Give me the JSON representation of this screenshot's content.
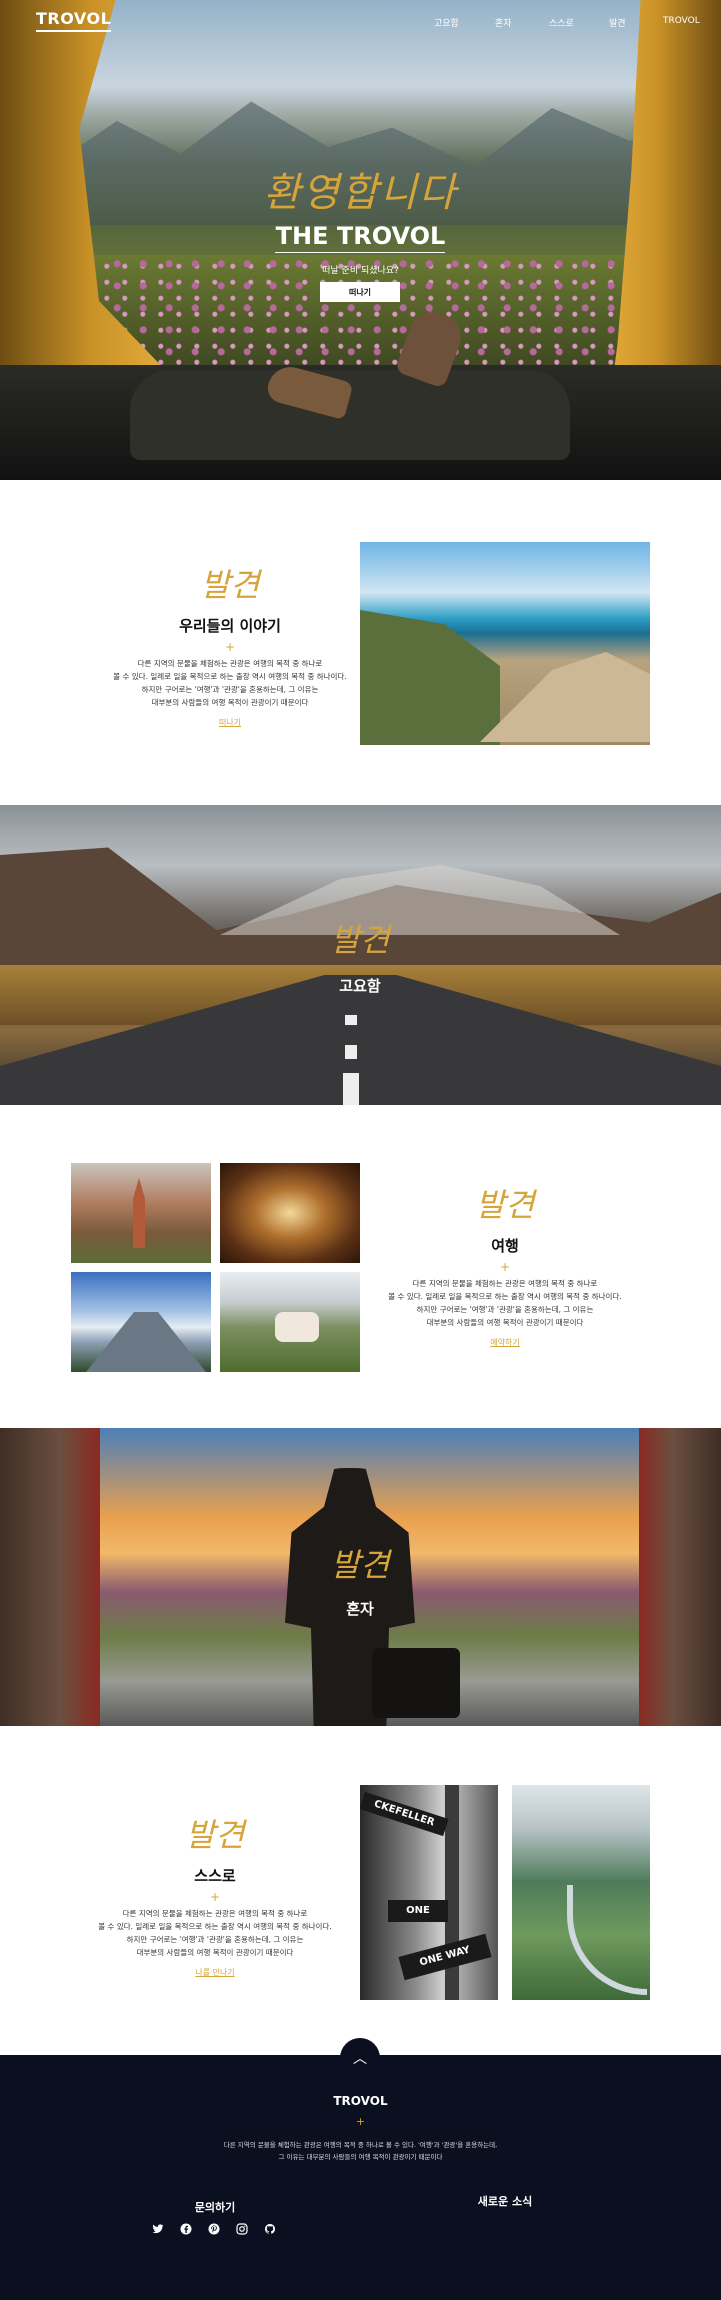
{
  "brand": {
    "logo": "TROVOL"
  },
  "nav": {
    "items": [
      "고요함",
      "혼자",
      "스스로",
      "발견",
      "TROVOL"
    ]
  },
  "hero": {
    "script": "환영합니다",
    "title": "THE TROVOL",
    "subtitle": "떠날 준비 되셨나요?",
    "button": "떠나기"
  },
  "story": {
    "script": "발견",
    "title": "우리들의 이야기",
    "plus": "+",
    "lines": [
      "다른 지역의 문물을 체험하는 관광은 여행의 목적 중 하나로",
      "볼 수 있다. 일례로 일을 목적으로 하는 출장 역시 여행의 목적 중 하나이다.",
      "하지만 구어로는 '여행'과 '관광'을 혼용하는데, 그 이유는",
      "대부분의 사람들의 여행 목적이 관광이기 때문이다"
    ],
    "link": "떠나기"
  },
  "calm": {
    "script": "발견",
    "title": "고요함"
  },
  "travel": {
    "script": "발견",
    "title": "여행",
    "plus": "+",
    "lines": [
      "다른 지역의 문물을 체험하는 관광은 여행의 목적 중 하나로",
      "볼 수 있다. 일례로 일을 목적으로 하는 출장 역시 여행의 목적 중 하나이다.",
      "하지만 구어로는 '여행'과 '관광'을 혼용하는데, 그 이유는",
      "대부분의 사람들의 여행 목적이 관광이기 때문이다"
    ],
    "link": "예약하기"
  },
  "alone": {
    "script": "발견",
    "title": "혼자"
  },
  "self": {
    "script": "발견",
    "title": "스스로",
    "plus": "+",
    "lines": [
      "다른 지역의 문물을 체험하는 관광은 여행의 목적 중 하나로",
      "볼 수 있다. 일례로 일을 목적으로 하는 출장 역시 여행의 목적 중 하나이다.",
      "하지만 구어로는 '여행'과 '관광'을 혼용하는데, 그 이유는",
      "대부분의 사람들의 여행 목적이 관광이기 때문이다"
    ],
    "link": "나를 만나기",
    "signs": [
      "CKEFELLER",
      "ONE",
      "ONE WAY"
    ]
  },
  "footer": {
    "top_button": "︿",
    "logo": "TROVOL",
    "plus": "+",
    "lines": [
      "다른 지역의 문물을 체험하는 관광은 여행의 목적 중 하나로 볼 수 있다. '여행'과 '관광'을 혼용하는데,",
      "그 이유는 대부분의 사람들의 여행 목적이 관광이기 때문이다"
    ],
    "contact_heading": "문의하기",
    "news_heading": "새로운 소식",
    "social_icons": [
      "twitter-icon",
      "facebook-icon",
      "pinterest-icon",
      "instagram-icon",
      "github-icon"
    ]
  },
  "colors": {
    "accent": "#d6a53a",
    "footer_bg": "#0b1020"
  }
}
